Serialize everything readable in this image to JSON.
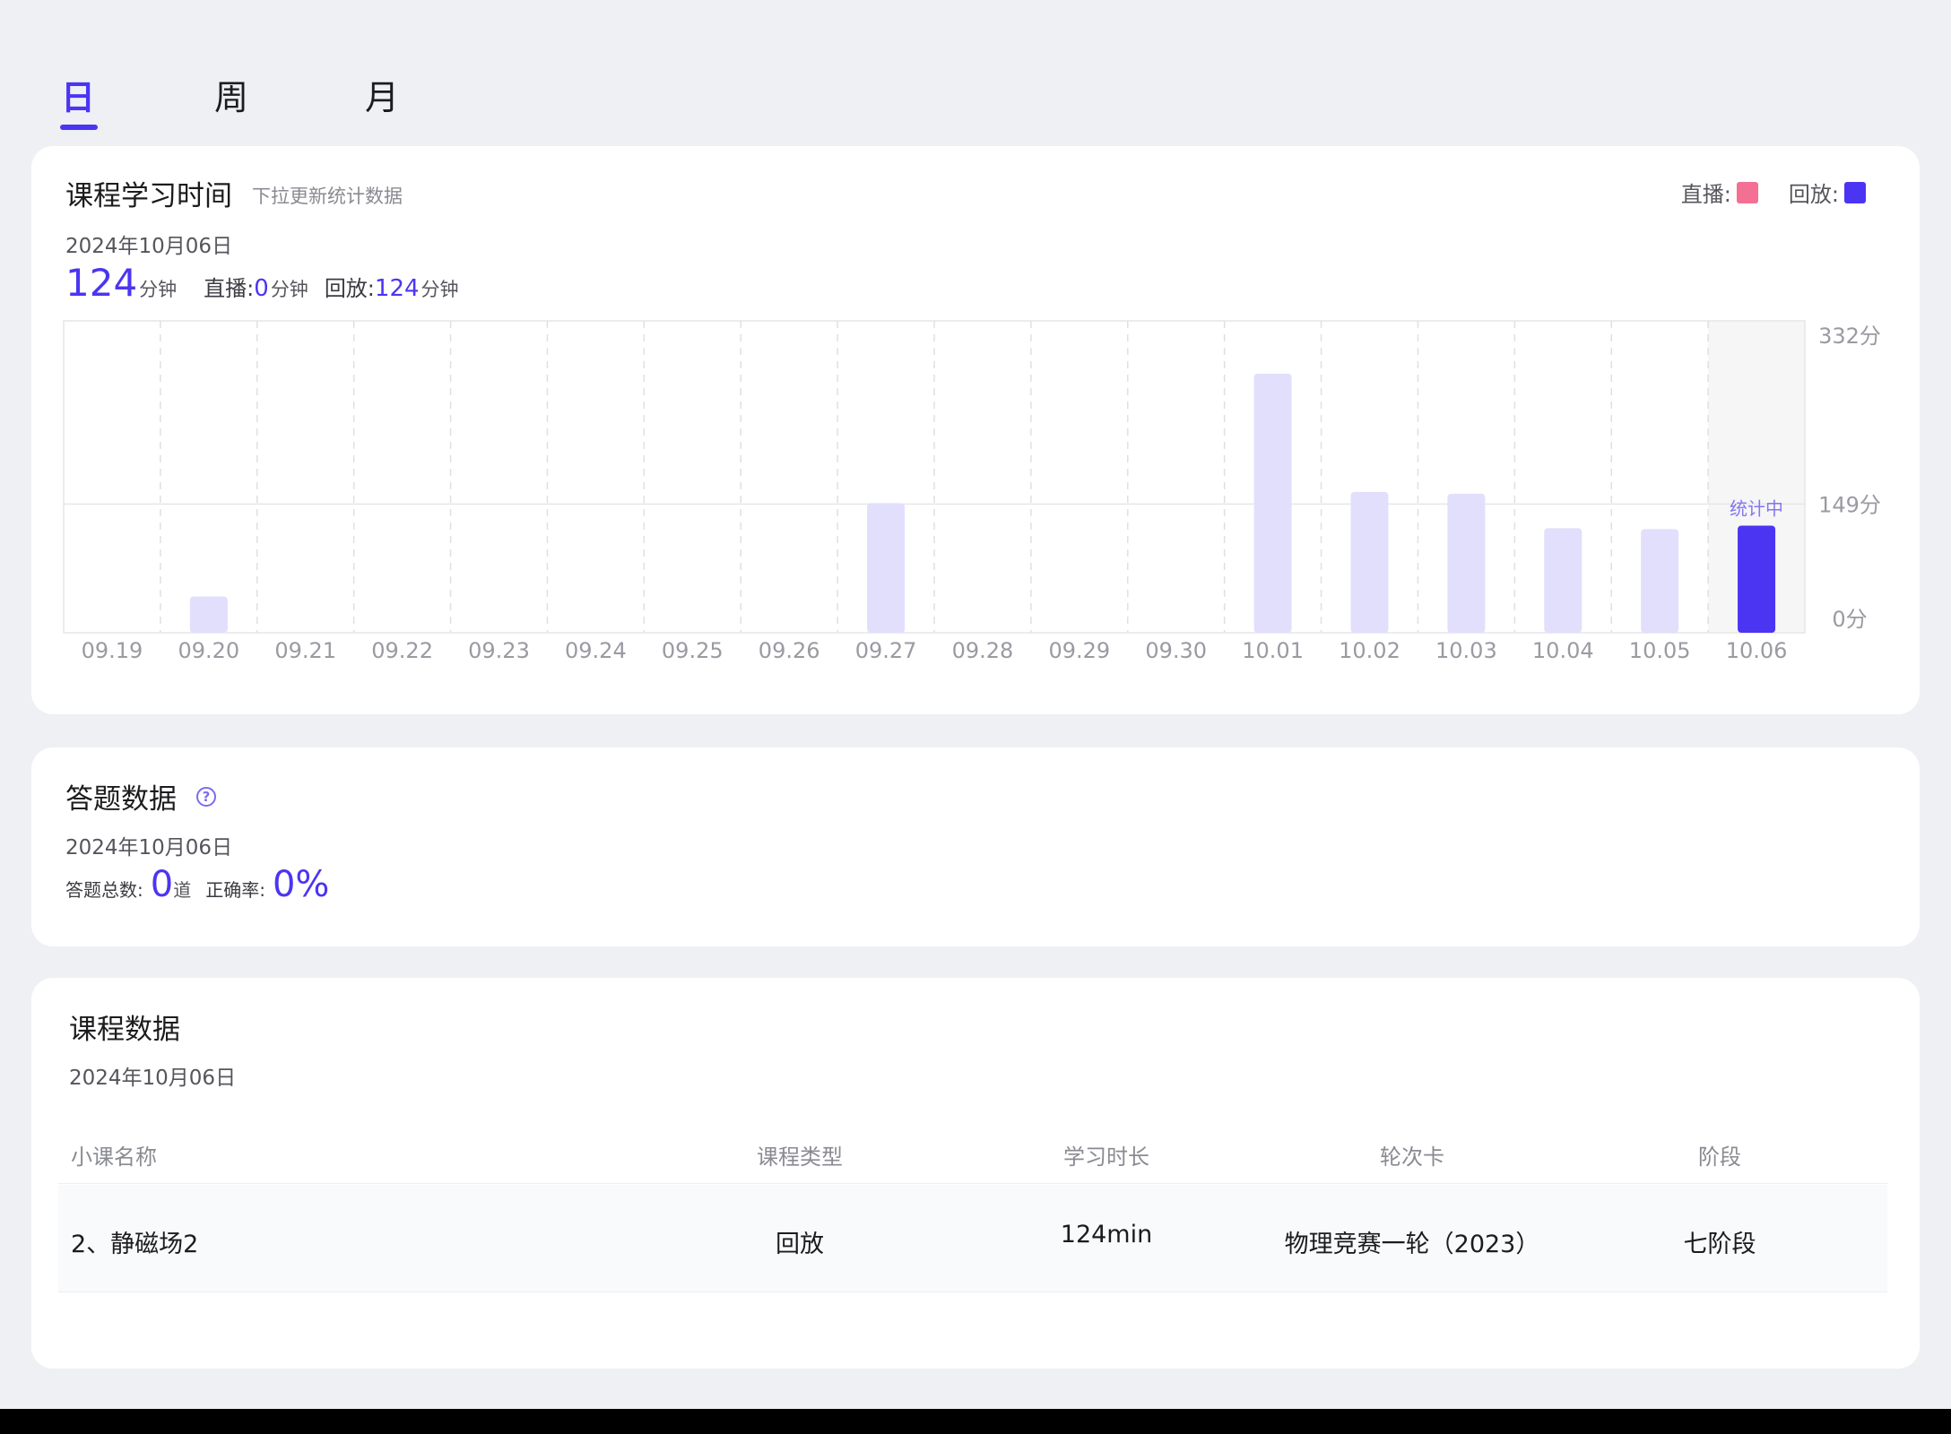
{
  "tabs": [
    {
      "label": "日",
      "active": true
    },
    {
      "label": "周",
      "active": false
    },
    {
      "label": "月",
      "active": false
    }
  ],
  "study_time": {
    "title": "课程学习时间",
    "subtitle": "下拉更新统计数据",
    "legend": [
      {
        "label": "直播:",
        "color": "#f46f94"
      },
      {
        "label": "回放:",
        "color": "#4b35f2"
      }
    ],
    "date": "2024年10月06日",
    "total_value": "124",
    "total_unit": "分钟",
    "live_label": "直播:",
    "live_value": "0",
    "live_unit": "分钟",
    "replay_label": "回放:",
    "replay_value": "124",
    "replay_unit": "分钟"
  },
  "chart_data": {
    "type": "bar",
    "categories": [
      "09.19",
      "09.20",
      "09.21",
      "09.22",
      "09.23",
      "09.24",
      "09.25",
      "09.26",
      "09.27",
      "09.28",
      "09.29",
      "09.30",
      "10.01",
      "10.02",
      "10.03",
      "10.04",
      "10.05",
      "10.06"
    ],
    "values": [
      0,
      42,
      0,
      0,
      0,
      0,
      0,
      0,
      150,
      0,
      0,
      0,
      300,
      163,
      161,
      121,
      120,
      124
    ],
    "y_ticks": [
      {
        "value": 332,
        "label": "332分"
      },
      {
        "value": 149,
        "label": "149分"
      },
      {
        "value": 0,
        "label": "0分"
      }
    ],
    "ylim": [
      0,
      332
    ],
    "highlight_index": 17,
    "highlight_label": "统计中",
    "colors": {
      "bar": "#e2dffd",
      "highlight": "#4b35f2",
      "label": "#8577ef"
    }
  },
  "answer": {
    "title": "答题数据",
    "help_icon": "?",
    "date": "2024年10月06日",
    "total_label": "答题总数:",
    "total_value": "0",
    "total_unit": "道",
    "accuracy_label": "正确率:",
    "accuracy_value": "0%"
  },
  "course": {
    "title": "课程数据",
    "date": "2024年10月06日",
    "columns": [
      "小课名称",
      "课程类型",
      "学习时长",
      "轮次卡",
      "阶段"
    ],
    "rows": [
      {
        "name": "2、静磁场2",
        "type": "回放",
        "duration": "124min",
        "round": "物理竞赛一轮（2023）",
        "stage": "七阶段"
      }
    ]
  }
}
